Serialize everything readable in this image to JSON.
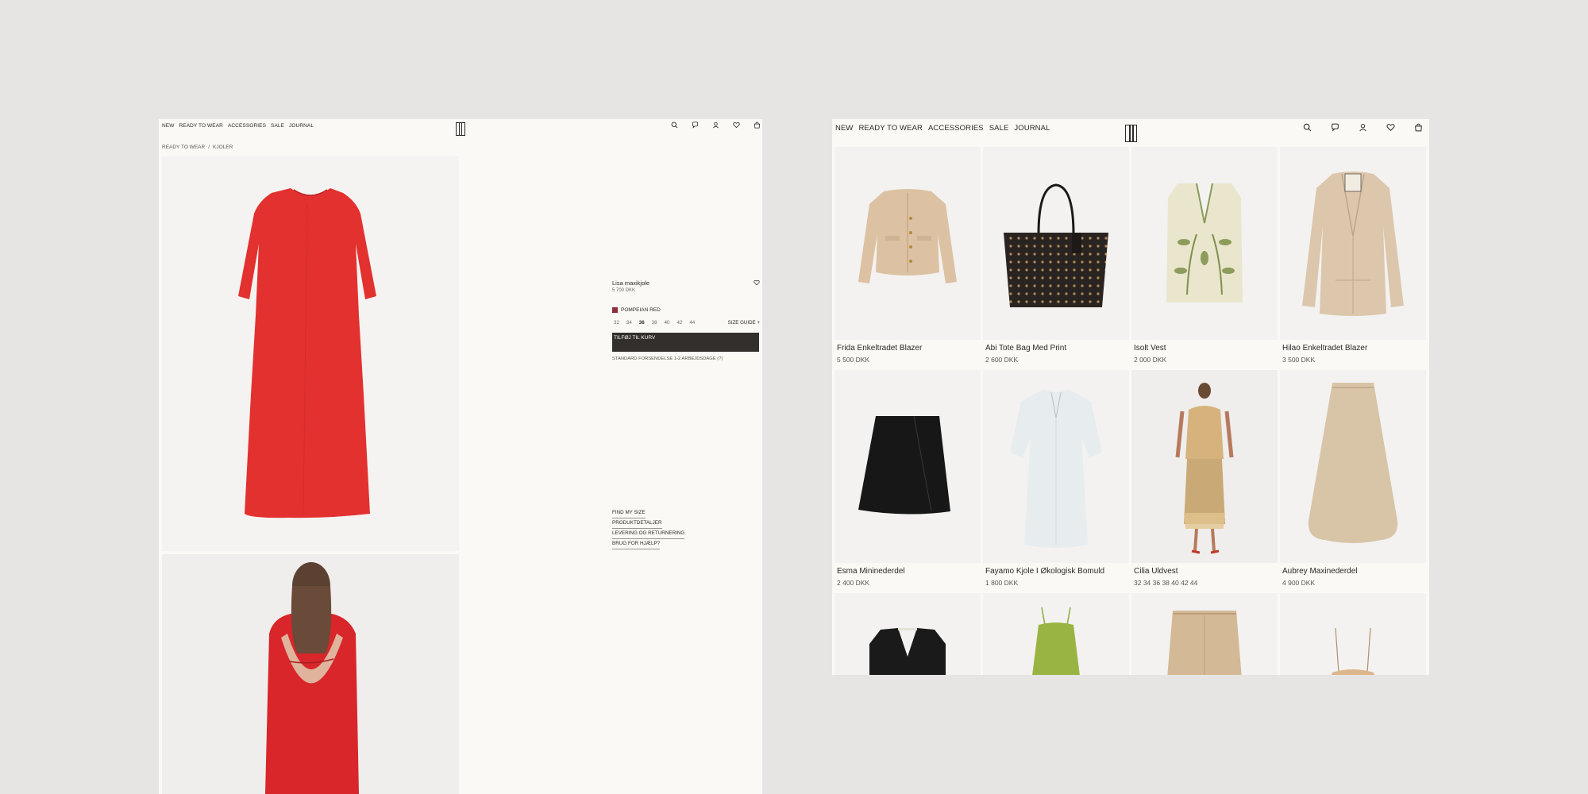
{
  "product_page": {
    "nav": [
      "NEW",
      "READY TO WEAR",
      "ACCESSORIES",
      "SALE",
      "JOURNAL"
    ],
    "header_icons": [
      "search-icon",
      "chat-icon",
      "account-icon",
      "wishlist-icon",
      "bag-icon"
    ],
    "breadcrumb": [
      "READY TO WEAR",
      "/",
      "KJOLER"
    ],
    "product": {
      "name": "Lisa maxikjole",
      "price": "5 700 DKK",
      "color_name": "POMPEIAN RED",
      "color_hex": "#8c3038",
      "sizes": [
        "32",
        "34",
        "36",
        "38",
        "40",
        "42",
        "44"
      ],
      "selected_size": "36",
      "size_guide": "SIZE GUIDE +",
      "add_to_cart": "TILFØJ TIL KURV",
      "delivery": "STANDARD FORSENDELSE 1-2 ARBEJDSDAGE (?)"
    },
    "links": [
      "FIND MY SIZE",
      "PRODUKTDETALJER",
      "LEVERING OG RETURNERING",
      "BRUG FOR HJÆLP?"
    ]
  },
  "category_page": {
    "nav": [
      "NEW",
      "READY TO WEAR",
      "ACCESSORIES",
      "SALE",
      "JOURNAL"
    ],
    "header_icons": [
      "search-icon",
      "chat-icon",
      "account-icon",
      "wishlist-icon",
      "bag-icon"
    ],
    "products": [
      {
        "name": "Frida Enkeltradet Blazer",
        "price": "5 500 DKK"
      },
      {
        "name": "Abi Tote Bag Med Print",
        "price": "2 600 DKK"
      },
      {
        "name": "Isolt Vest",
        "price": "2 000 DKK"
      },
      {
        "name": "Hilao Enkeltradet Blazer",
        "price": "3 500 DKK"
      },
      {
        "name": "Esma Mininederdel",
        "price": "2 400 DKK"
      },
      {
        "name": "Fayamo Kjole I Økologisk Bomuld",
        "price": "1 800 DKK"
      },
      {
        "name": "Cilia Uldvest",
        "price": "32 34 36 38 40 42 44"
      },
      {
        "name": "Aubrey Maxinederdel",
        "price": "4 900 DKK"
      }
    ]
  },
  "colors": {
    "background": "#e6e5e3",
    "panel": "#faf9f6",
    "text": "#2b2926",
    "button": "#322f2c",
    "dress_red": "#e2312f"
  }
}
